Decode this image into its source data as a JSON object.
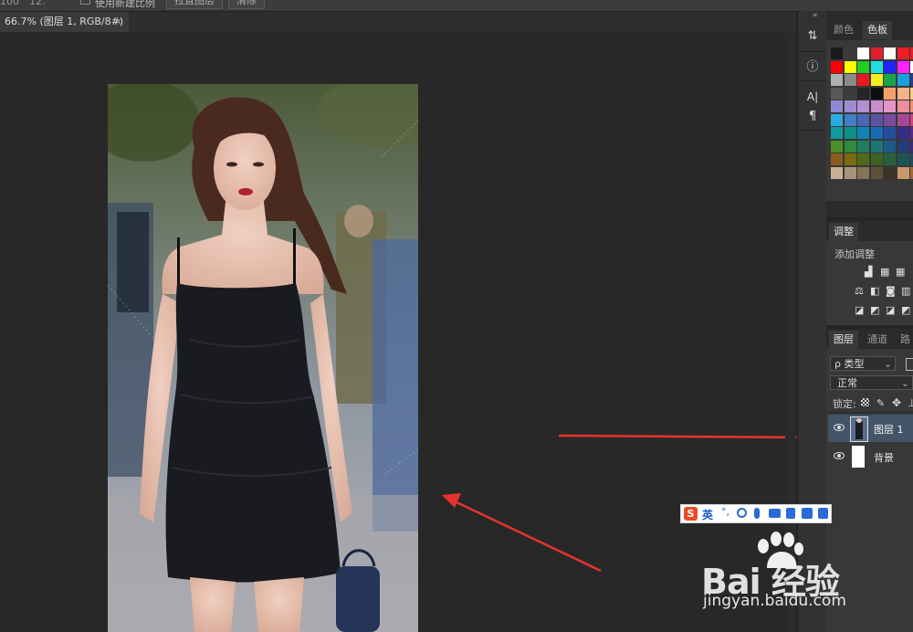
{
  "options_bar": {
    "zoom_value": "100",
    "scroll_label": "12.",
    "resize_label": "使用新建比例",
    "button_1": "拉直图层",
    "button_2": "清除"
  },
  "document_tab": {
    "title": "66.7% (图层 1, RGB/8#) *",
    "close_glyph": "×"
  },
  "toolstrip": {
    "collapse_glyph": "«",
    "items": [
      "⇅",
      "ⓘ",
      "A|",
      "¶"
    ]
  },
  "color_panel": {
    "tabs": [
      "颜色",
      "色板"
    ],
    "active_tab": "色板",
    "swatches": [
      [
        "#1a1a1a",
        "#3a3a3a",
        "#ffffff",
        "#e0202a",
        "#ffffff",
        "#f01d25",
        "#e62027"
      ],
      [
        "#ff0000",
        "#ffff00",
        "#22cc22",
        "#22e0e0",
        "#1e24ff",
        "#ff22ff",
        "#ffffff"
      ],
      [
        "#b0b0b0",
        "#8a8a8a",
        "#e8191e",
        "#f8ec1d",
        "#1aa54a",
        "#16a1e0",
        "#2a3990"
      ],
      [
        "#585858",
        "#3c3c3c",
        "#262626",
        "#0e0e0e",
        "#f2a26b",
        "#f6b38a",
        "#f9cf8a"
      ],
      [
        "#8d8ad2",
        "#9e8bd0",
        "#b28fd1",
        "#c88fcf",
        "#e594c7",
        "#ec8f9f",
        "#f19073"
      ],
      [
        "#2eaae2",
        "#3f7fc5",
        "#4a67b6",
        "#5a54a4",
        "#7a4c9e",
        "#a8479a",
        "#d0427e"
      ],
      [
        "#0f9aa0",
        "#0d8f8c",
        "#1184b8",
        "#176ab4",
        "#244c9b",
        "#352e86",
        "#572b82"
      ],
      [
        "#4d8f27",
        "#2f8b3d",
        "#1c7e5e",
        "#1c7474",
        "#1d5b86",
        "#233d7a",
        "#3b2c78"
      ],
      [
        "#8a5d1f",
        "#7b6a10",
        "#4f6b1a",
        "#3a6420",
        "#2a5f3d",
        "#1e5450",
        "#1f4a5e"
      ],
      [
        "#c8b193",
        "#a89479",
        "#867459",
        "#5e4e3c",
        "#3c3229",
        "#c89a6a",
        "#a06a3a"
      ]
    ]
  },
  "adjustments_panel": {
    "tab": "调整",
    "subtitle": "添加调整",
    "icons": [
      "brightness-icon",
      "levels-icon",
      "curves-icon",
      "exposure-icon",
      "vibrance-icon",
      "hue-icon",
      "balance-icon",
      "bw-icon",
      "photo-filter-icon",
      "invert-icon",
      "posterize-icon",
      "threshold-icon"
    ]
  },
  "layers_panel": {
    "tabs": [
      "图层",
      "通道",
      "路径"
    ],
    "active_tab": "图层",
    "filter_label": "ρ 类型",
    "blend_mode": "正常",
    "lock_label": "锁定:",
    "layers": [
      {
        "name": "图层 1",
        "selected": true
      },
      {
        "name": "背景",
        "selected": false
      }
    ]
  },
  "ime_bar": {
    "logo": "S",
    "lang": "英",
    "punct": "°,"
  },
  "watermark": {
    "logo": "Bai 经验",
    "url": "jingyan.baidu.com"
  }
}
